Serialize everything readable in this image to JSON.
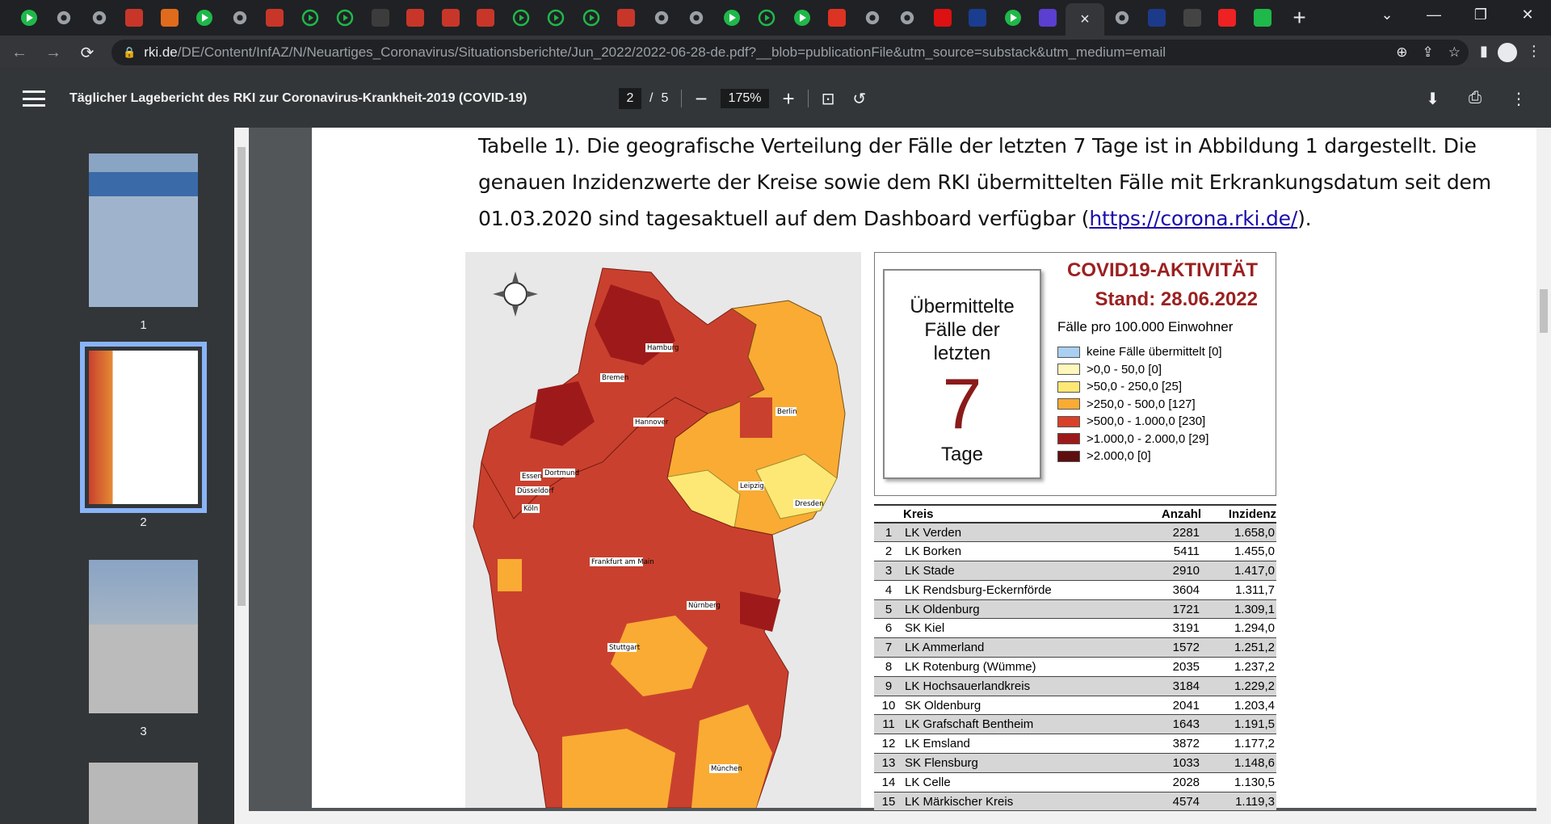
{
  "tabs": {
    "favicons": [
      "play",
      "globe",
      "globe",
      "BI",
      "rss",
      "play",
      "globe",
      "BI",
      "play-outline",
      "play-outline",
      "ET",
      "BI",
      "BI",
      "BI",
      "play-outline",
      "play-outline",
      "play-outline",
      "BI",
      "globe",
      "globe",
      "play",
      "play-outline",
      "play",
      "down-arrow",
      "shield",
      "globe",
      "opera",
      "film",
      "play",
      "purple-box",
      "close",
      "globe",
      "tv",
      "chart",
      "youtube",
      "g"
    ],
    "active_close": "×",
    "new_tab": "+"
  },
  "window": {
    "minimize": "⌄",
    "restore": "—",
    "maximize": "❐",
    "close": "✕"
  },
  "omnibox": {
    "host": "rki.de",
    "path": "/DE/Content/InfAZ/N/Neuartiges_Coronavirus/Situationsberichte/Jun_2022/2022-06-28-de.pdf?__blob=publicationFile&utm_source=substack&utm_medium=email"
  },
  "pdf": {
    "title": "Täglicher Lagebericht des RKI zur Coronavirus-Krankheit-2019 (COVID-19)",
    "current_page": "2",
    "total_pages": "5",
    "page_sep": "/",
    "zoom": "175%"
  },
  "thumbnails": [
    {
      "label": "1"
    },
    {
      "label": "2"
    },
    {
      "label": "3"
    }
  ],
  "body": {
    "line1": "Tabelle 1). Die geografische Verteilung der Fälle der letzten 7 Tage ist in Abbildung 1 dargestellt. Die",
    "line2": "genauen Inzidenzwerte der Kreise sowie dem RKI übermittelten Fälle mit Erkrankungsdatum seit dem",
    "line3_pre": "01.03.2020 sind tagesaktuell auf dem Dashboard verfügbar (",
    "link": "https://corona.rki.de/",
    "line3_post": ")."
  },
  "map": {
    "cities": [
      "Hamburg",
      "Bremen",
      "Hannover",
      "Berlin",
      "Essen",
      "Dortmund",
      "Düsseldorf",
      "Köln",
      "Leipzig",
      "Dresden",
      "Frankfurt am Main",
      "Nürnberg",
      "Stuttgart",
      "München"
    ]
  },
  "legend": {
    "title1": "COVID19-AKTIVITÄT",
    "title2": "Stand: 28.06.2022",
    "box_l1": "Übermittelte",
    "box_l2": "Fälle der",
    "box_l3": "letzten",
    "box_big": "7",
    "box_l4": "Tage",
    "subtitle": "Fälle pro 100.000 Einwohner",
    "items": [
      {
        "label": "keine Fälle übermittelt [0]",
        "color": "#a9d0f0"
      },
      {
        "label": ">0,0 - 50,0 [0]",
        "color": "#fff7bc"
      },
      {
        "label": ">50,0 - 250,0 [25]",
        "color": "#fee875"
      },
      {
        "label": ">250,0 - 500,0 [127]",
        "color": "#f9ab34"
      },
      {
        "label": ">500,0 - 1.000,0 [230]",
        "color": "#d9402a"
      },
      {
        "label": ">1.000,0 - 2.000,0 [29]",
        "color": "#9e1a1a"
      },
      {
        "label": ">2.000,0 [0]",
        "color": "#5e0e0e"
      }
    ]
  },
  "table": {
    "headers": [
      "",
      "Kreis",
      "Anzahl",
      "Inzidenz"
    ],
    "rows": [
      [
        "1",
        "LK Verden",
        "2281",
        "1.658,0"
      ],
      [
        "2",
        "LK Borken",
        "5411",
        "1.455,0"
      ],
      [
        "3",
        "LK Stade",
        "2910",
        "1.417,0"
      ],
      [
        "4",
        "LK Rendsburg-Eckernförde",
        "3604",
        "1.311,7"
      ],
      [
        "5",
        "LK Oldenburg",
        "1721",
        "1.309,1"
      ],
      [
        "6",
        "SK Kiel",
        "3191",
        "1.294,0"
      ],
      [
        "7",
        "LK Ammerland",
        "1572",
        "1.251,2"
      ],
      [
        "8",
        "LK Rotenburg (Wümme)",
        "2035",
        "1.237,2"
      ],
      [
        "9",
        "LK Hochsauerlandkreis",
        "3184",
        "1.229,2"
      ],
      [
        "10",
        "SK Oldenburg",
        "2041",
        "1.203,4"
      ],
      [
        "11",
        "LK Grafschaft Bentheim",
        "1643",
        "1.191,5"
      ],
      [
        "12",
        "LK Emsland",
        "3872",
        "1.177,2"
      ],
      [
        "13",
        "SK Flensburg",
        "1033",
        "1.148,6"
      ],
      [
        "14",
        "LK Celle",
        "2028",
        "1.130,5"
      ],
      [
        "15",
        "LK Märkischer Kreis",
        "4574",
        "1.119,3"
      ]
    ]
  }
}
